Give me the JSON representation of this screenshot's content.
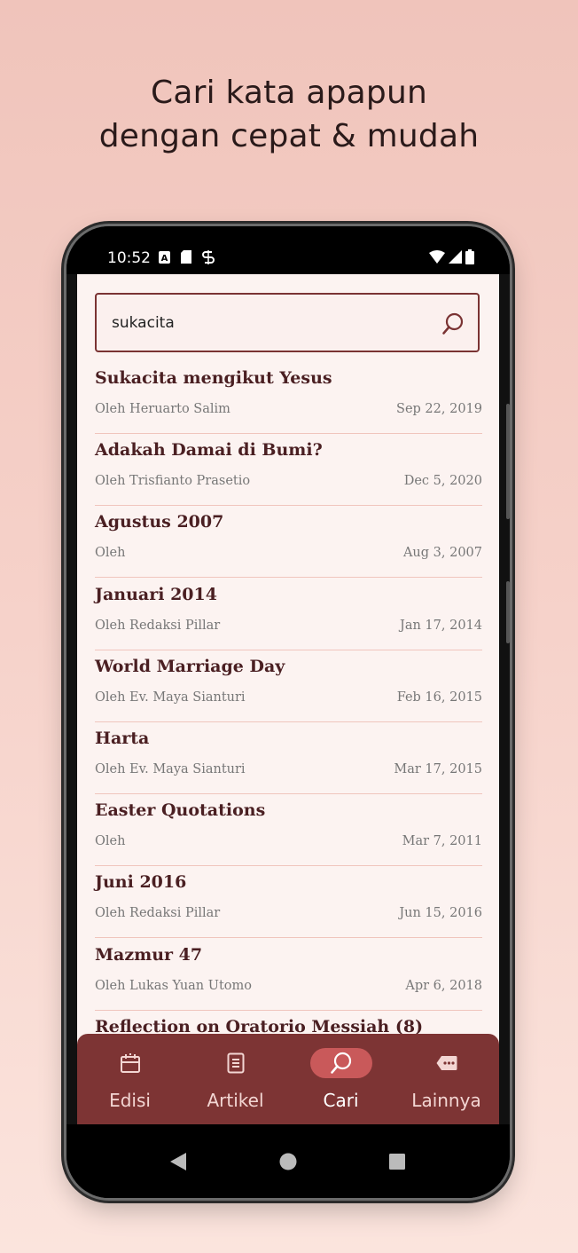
{
  "headline": {
    "line1": "Cari kata apapun",
    "line2": "dengan cepat & mudah"
  },
  "status_bar": {
    "time": "10:52",
    "icons": [
      "a-badge-icon",
      "sd-card-icon",
      "sync-icon",
      "wifi-icon",
      "cellular-icon",
      "battery-icon"
    ]
  },
  "search": {
    "value": "sukacita",
    "icon": "search-icon"
  },
  "results": [
    {
      "title": "Sukacita mengikut Yesus",
      "author": "Oleh Heruarto Salim",
      "date": "Sep 22, 2019"
    },
    {
      "title": "Adakah Damai di Bumi?",
      "author": "Oleh Trisfianto Prasetio",
      "date": "Dec 5, 2020"
    },
    {
      "title": "Agustus 2007",
      "author": "Oleh",
      "date": "Aug 3, 2007"
    },
    {
      "title": "Januari 2014",
      "author": "Oleh Redaksi Pillar",
      "date": "Jan 17, 2014"
    },
    {
      "title": "World Marriage Day",
      "author": "Oleh Ev. Maya Sianturi",
      "date": "Feb 16, 2015"
    },
    {
      "title": "Harta",
      "author": "Oleh Ev. Maya Sianturi",
      "date": "Mar 17, 2015"
    },
    {
      "title": "Easter Quotations",
      "author": "Oleh",
      "date": "Mar 7, 2011"
    },
    {
      "title": "Juni 2016",
      "author": "Oleh Redaksi Pillar",
      "date": "Jun 15, 2016"
    },
    {
      "title": "Mazmur 47",
      "author": "Oleh Lukas Yuan Utomo",
      "date": "Apr 6, 2018"
    },
    {
      "title": "Reflection on Oratorio Messiah (8)",
      "author": "",
      "date": ""
    }
  ],
  "bottom_nav": {
    "items": [
      {
        "label": "Edisi",
        "icon": "calendar-icon"
      },
      {
        "label": "Artikel",
        "icon": "article-icon"
      },
      {
        "label": "Cari",
        "icon": "search-icon",
        "active": true
      },
      {
        "label": "Lainnya",
        "icon": "more-icon"
      }
    ]
  },
  "colors": {
    "accent": "#7d3434",
    "active_pill": "#c9595a",
    "title_text": "#4a1f22",
    "divider": "#f0c5bd",
    "background_top": "#f0c4bb",
    "background_bottom": "#fbe4dd"
  }
}
